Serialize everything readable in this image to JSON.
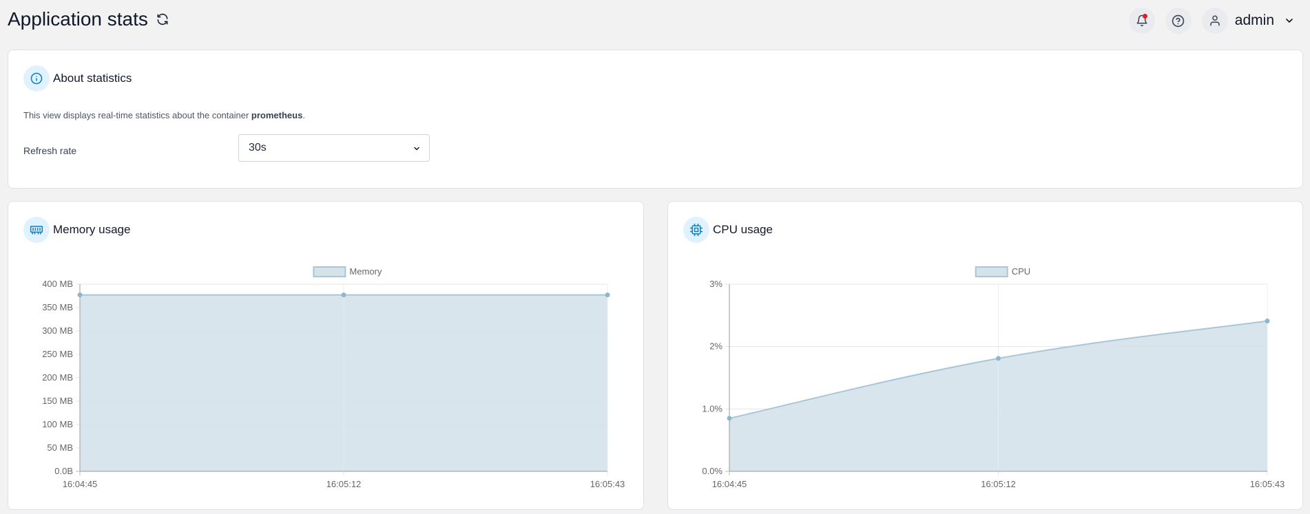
{
  "header": {
    "title": "Application stats",
    "user": "admin"
  },
  "about": {
    "title": "About statistics",
    "desc_prefix": "This view displays real-time statistics about the container ",
    "container_name": "prometheus",
    "desc_suffix": ".",
    "refresh_label": "Refresh rate",
    "refresh_value": "30s"
  },
  "memory": {
    "title": "Memory usage"
  },
  "cpu": {
    "title": "CPU usage"
  },
  "colors": {
    "accent": "#0b7ec2",
    "area_fill": "#d4e2ea",
    "area_line": "#a8c6d6",
    "point": "#8fb7cb",
    "notification": "#e11d2a"
  },
  "icons": {
    "refresh": "refresh-icon",
    "bell": "bell-icon",
    "help": "help-icon",
    "user": "user-icon",
    "info": "info-icon",
    "memory": "memory-icon",
    "cpu": "cpu-icon"
  },
  "chart_data": [
    {
      "type": "area",
      "legend": "Memory",
      "x": [
        "16:04:45",
        "16:05:12",
        "16:05:43"
      ],
      "values": [
        377,
        377,
        377
      ],
      "ylim": [
        0,
        400
      ],
      "yticks": [
        0,
        50,
        100,
        150,
        200,
        250,
        300,
        350,
        400
      ],
      "ytick_labels": [
        "0.0B",
        "50 MB",
        "100 MB",
        "150 MB",
        "200 MB",
        "250 MB",
        "300 MB",
        "350 MB",
        "400 MB"
      ],
      "grid": true,
      "legend_placement": "top-center"
    },
    {
      "type": "area",
      "legend": "CPU",
      "x": [
        "16:04:45",
        "16:05:12",
        "16:05:43"
      ],
      "values": [
        0.85,
        1.81,
        2.41
      ],
      "ylim": [
        0,
        3
      ],
      "yticks": [
        0,
        1,
        2,
        3
      ],
      "ytick_labels": [
        "0.0%",
        "1.0%",
        "2%",
        "3%"
      ],
      "grid": true,
      "legend_placement": "top-center"
    }
  ]
}
